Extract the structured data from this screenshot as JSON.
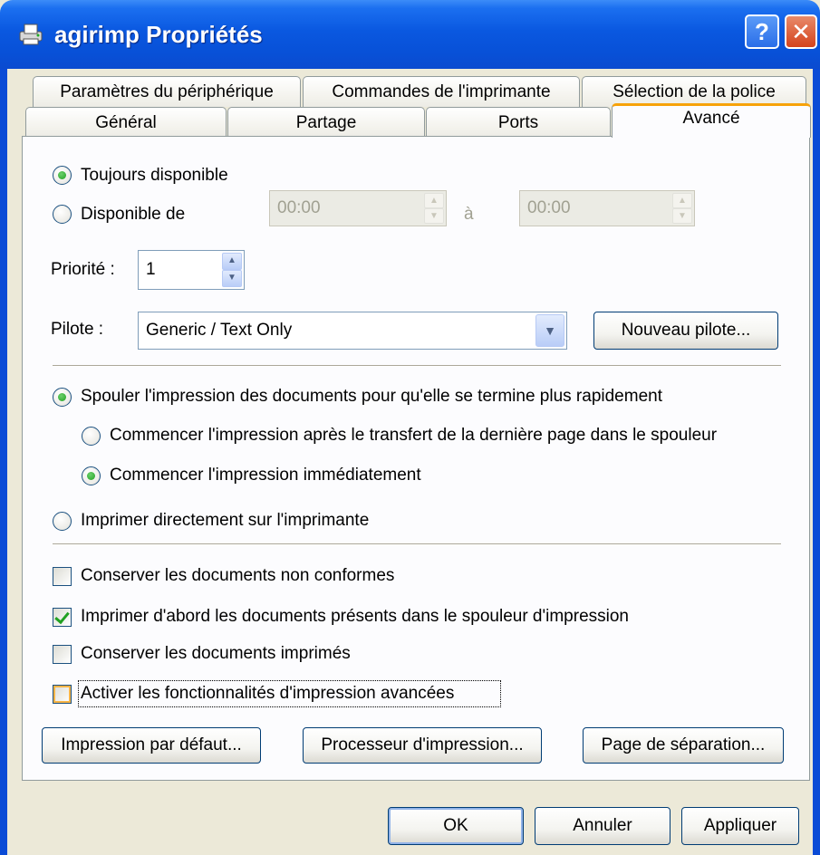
{
  "window": {
    "title": "agirimp Propriétés",
    "help_label": "?",
    "close_label": "✕"
  },
  "tabs": {
    "row_top": [
      "Paramètres du périphérique",
      "Commandes de l'imprimante",
      "Sélection de la police"
    ],
    "row_bottom": [
      "Général",
      "Partage",
      "Ports",
      "Avancé"
    ],
    "active": "Avancé"
  },
  "availability": {
    "always_label": "Toujours disponible",
    "from_label": "Disponible de",
    "from_time": "00:00",
    "to_label": "à",
    "to_time": "00:00",
    "selected": "always"
  },
  "priority": {
    "label": "Priorité :",
    "value": "1"
  },
  "driver": {
    "label": "Pilote :",
    "selected": "Generic / Text Only",
    "new_driver_button": "Nouveau pilote..."
  },
  "spool": {
    "spool_label": "Spouler l'impression des documents pour qu'elle se termine plus rapidement",
    "after_last_page_label": "Commencer l'impression après le transfert de la dernière page dans le spouleur",
    "immediately_label": "Commencer l'impression immédiatement",
    "direct_label": "Imprimer directement sur l'imprimante"
  },
  "options": {
    "hold_mismatched": {
      "label": "Conserver les documents non conformes",
      "checked": false
    },
    "print_spooled_first": {
      "label": "Imprimer d'abord les documents présents dans le spouleur d'impression",
      "checked": true
    },
    "keep_printed": {
      "label": "Conserver les documents imprimés",
      "checked": false
    },
    "advanced_features": {
      "label": "Activer les fonctionnalités d'impression avancées",
      "checked": false
    }
  },
  "panel_buttons": {
    "defaults": "Impression par défaut...",
    "processor": "Processeur d'impression...",
    "separator": "Page de séparation..."
  },
  "dialog_buttons": {
    "ok": "OK",
    "cancel": "Annuler",
    "apply": "Appliquer"
  }
}
